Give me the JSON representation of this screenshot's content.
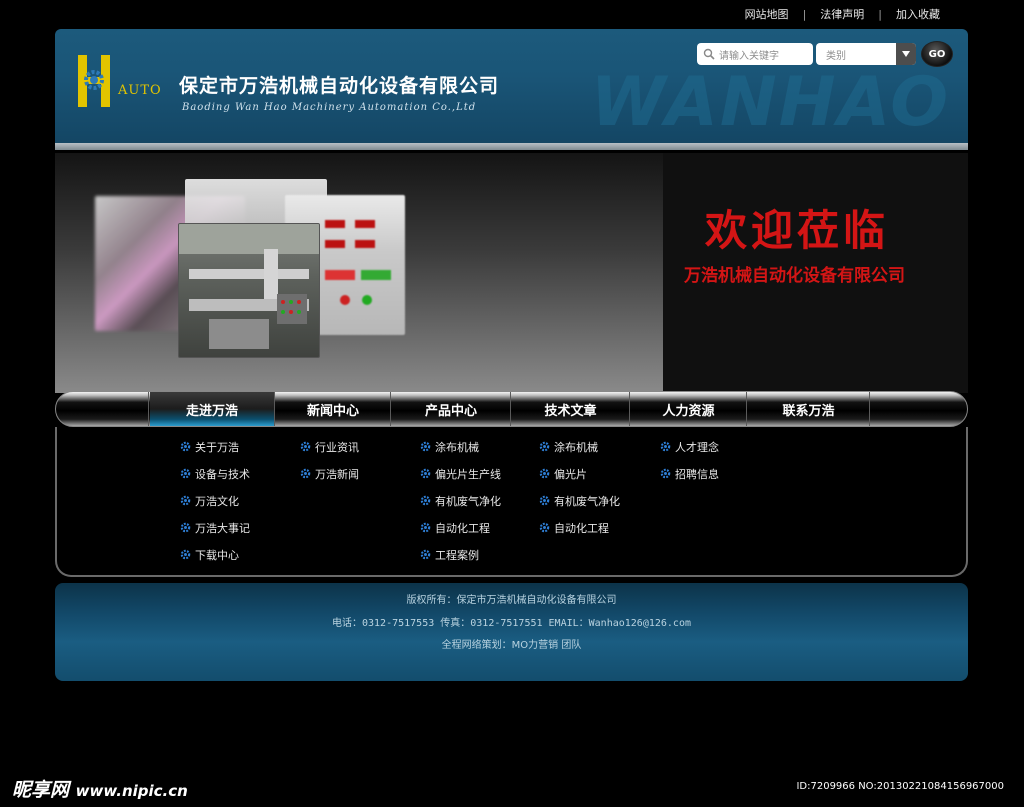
{
  "top_links": [
    "网站地图",
    "法律声明",
    "加入收藏"
  ],
  "header": {
    "logo_letters": "AUTO",
    "company_cn": "保定市万浩机械自动化设备有限公司",
    "company_en": "Baoding Wan Hao Machinery Automation Co.,Ltd",
    "watermark": "WANHAO",
    "search_placeholder": "请输入关键字",
    "category_label": "类别",
    "go_label": "GO"
  },
  "banner": {
    "welcome": "欢迎莅临",
    "welcome_sub": "万浩机械自动化设备有限公司"
  },
  "nav": {
    "items": [
      "走进万浩",
      "新闻中心",
      "产品中心",
      "技术文章",
      "人力资源",
      "联系万浩"
    ],
    "active_index": 0
  },
  "submenu": [
    [
      "关于万浩",
      "设备与技术",
      "万浩文化",
      "万浩大事记",
      "下载中心"
    ],
    [
      "行业资讯",
      "万浩新闻"
    ],
    [
      "涂布机械",
      "偏光片生产线",
      "有机废气净化",
      "自动化工程",
      "工程案例"
    ],
    [
      "涂布机械",
      "偏光片",
      "有机废气净化",
      "自动化工程"
    ],
    [
      "人才理念",
      "招聘信息"
    ],
    []
  ],
  "footer": {
    "copyright": "版权所有：保定市万浩机械自动化设备有限公司",
    "contact": "电话：0312-7517553  传真：0312-7517551  EMAIL：Wanhao126@126.com",
    "credit": "全程网络策划：MO力营销 团队"
  },
  "source_watermark": {
    "brand": "昵享网",
    "url": "www.nipic.cn",
    "image_id": "ID:7209966 NO:20130221084156967000"
  },
  "colors": {
    "header_blue": "#1a5577",
    "welcome_red": "#d41515",
    "logo_yellow": "#e2c400",
    "active_tab_blue": "#2b9ed0"
  }
}
